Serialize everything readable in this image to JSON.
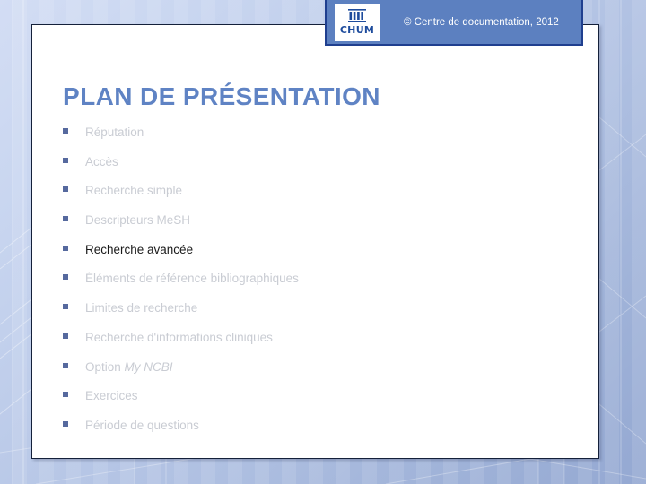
{
  "slide": {
    "title": "PLAN DE PRÉSENTATION",
    "title_color": "#5f83c4",
    "panel_background": "#ffffff"
  },
  "header": {
    "copyright": "© Centre de documentation, 2012",
    "bar_color": "#5c80c0",
    "bar_border_color": "#1f3f8f",
    "logo": {
      "icon_name": "chum-building-icon",
      "wordmark": "CHUM",
      "wordmark_color": "#1d4b9c"
    }
  },
  "agenda": {
    "bullet_color": "#56699e",
    "muted_text_color": "#c9ccd3",
    "active_text_color": "#1a1a1a",
    "items": [
      {
        "label": "Réputation",
        "active": false
      },
      {
        "label": "Accès",
        "active": false
      },
      {
        "label": "Recherche simple",
        "active": false
      },
      {
        "label": "Descripteurs MeSH",
        "active": false
      },
      {
        "label": "Recherche avancée",
        "active": true
      },
      {
        "label": "Éléments de référence bibliographiques",
        "active": false
      },
      {
        "label": "Limites de recherche",
        "active": false
      },
      {
        "label": "Recherche d'informations cliniques",
        "active": false
      },
      {
        "label": "Option My NCBI",
        "active": false,
        "italic_part": "My NCBI",
        "plain_part": "Option "
      },
      {
        "label": "Exercices",
        "active": false
      },
      {
        "label": "Période de questions",
        "active": false
      }
    ]
  }
}
